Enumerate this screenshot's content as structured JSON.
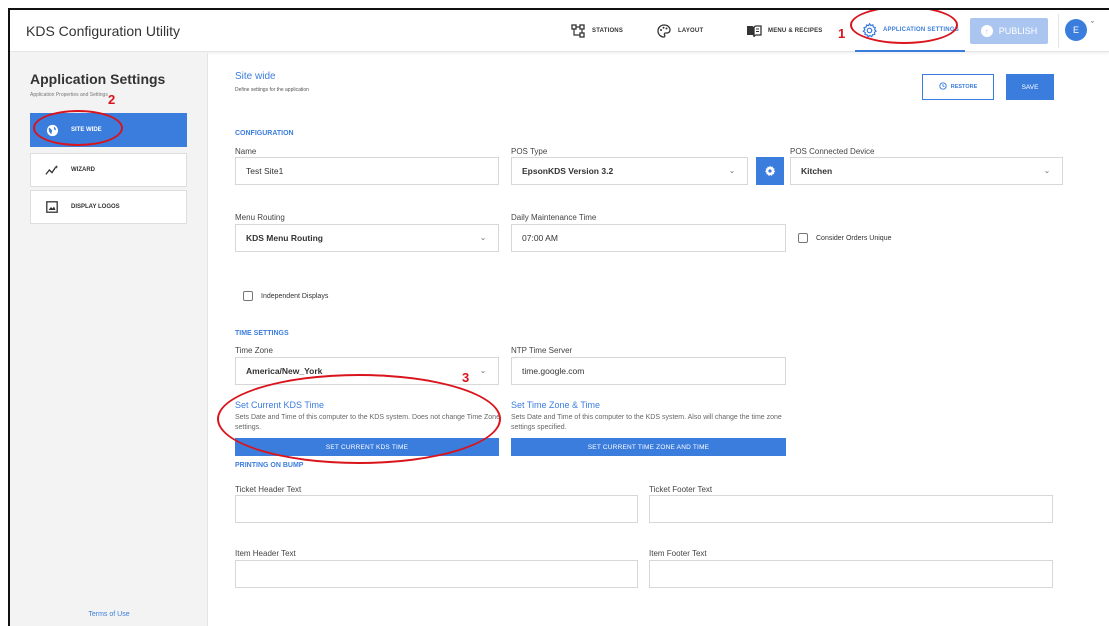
{
  "app": {
    "title": "KDS Configuration Utility"
  },
  "nav": {
    "items": [
      {
        "label": "STATIONS",
        "icon": "stations-icon"
      },
      {
        "label": "LAYOUT",
        "icon": "palette-icon"
      },
      {
        "label": "MENU & RECIPES",
        "icon": "book-icon"
      },
      {
        "label": "APPLICATION SETTINGS",
        "icon": "gear-icon"
      }
    ],
    "publish": "PUBLISH",
    "avatar": "E"
  },
  "sidebar": {
    "title": "Application Settings",
    "subtitle": "Application Properties and Settings",
    "items": [
      {
        "label": "SITE WIDE",
        "icon": "globe-icon"
      },
      {
        "label": "WIZARD",
        "icon": "wand-icon"
      },
      {
        "label": "DISPLAY LOGOS",
        "icon": "image-icon"
      }
    ],
    "terms": "Terms of Use"
  },
  "page": {
    "title": "Site wide",
    "subtitle": "Define settings for the application",
    "restore": "RESTORE",
    "save": "SAVE"
  },
  "config": {
    "section": "CONFIGURATION",
    "name_label": "Name",
    "name_value": "Test Site1",
    "pos_type_label": "POS Type",
    "pos_type_value": "EpsonKDS Version 3.2",
    "pos_device_label": "POS Connected Device",
    "pos_device_value": "Kitchen",
    "menu_routing_label": "Menu Routing",
    "menu_routing_value": "KDS Menu Routing",
    "maintenance_label": "Daily Maintenance Time",
    "maintenance_value": "07:00 AM",
    "unique_label": "Consider Orders Unique",
    "independent_label": "Independent Displays"
  },
  "time": {
    "section": "TIME SETTINGS",
    "tz_label": "Time Zone",
    "tz_value": "America/New_York",
    "ntp_label": "NTP Time Server",
    "ntp_value": "time.google.com",
    "set_kds_title": "Set Current KDS Time",
    "set_kds_desc": "Sets Date and Time of this computer to the KDS system. Does not change Time Zone settings.",
    "set_kds_btn": "SET CURRENT KDS TIME",
    "set_tz_title": "Set Time Zone & Time",
    "set_tz_desc": "Sets Date and Time of this computer to the KDS system. Also will change the time zone settings specified.",
    "set_tz_btn": "SET CURRENT TIME ZONE AND TIME"
  },
  "printing": {
    "section": "PRINTING ON BUMP",
    "ticket_header_label": "Ticket Header Text",
    "ticket_footer_label": "Ticket Footer Text",
    "item_header_label": "Item Header Text",
    "item_footer_label": "Item Footer Text"
  },
  "annotations": {
    "one": "1",
    "two": "2",
    "three": "3"
  },
  "colors": {
    "accent": "#3b7ddd",
    "annotation": "#d9141c",
    "publish_disabled": "#aac6f0"
  }
}
